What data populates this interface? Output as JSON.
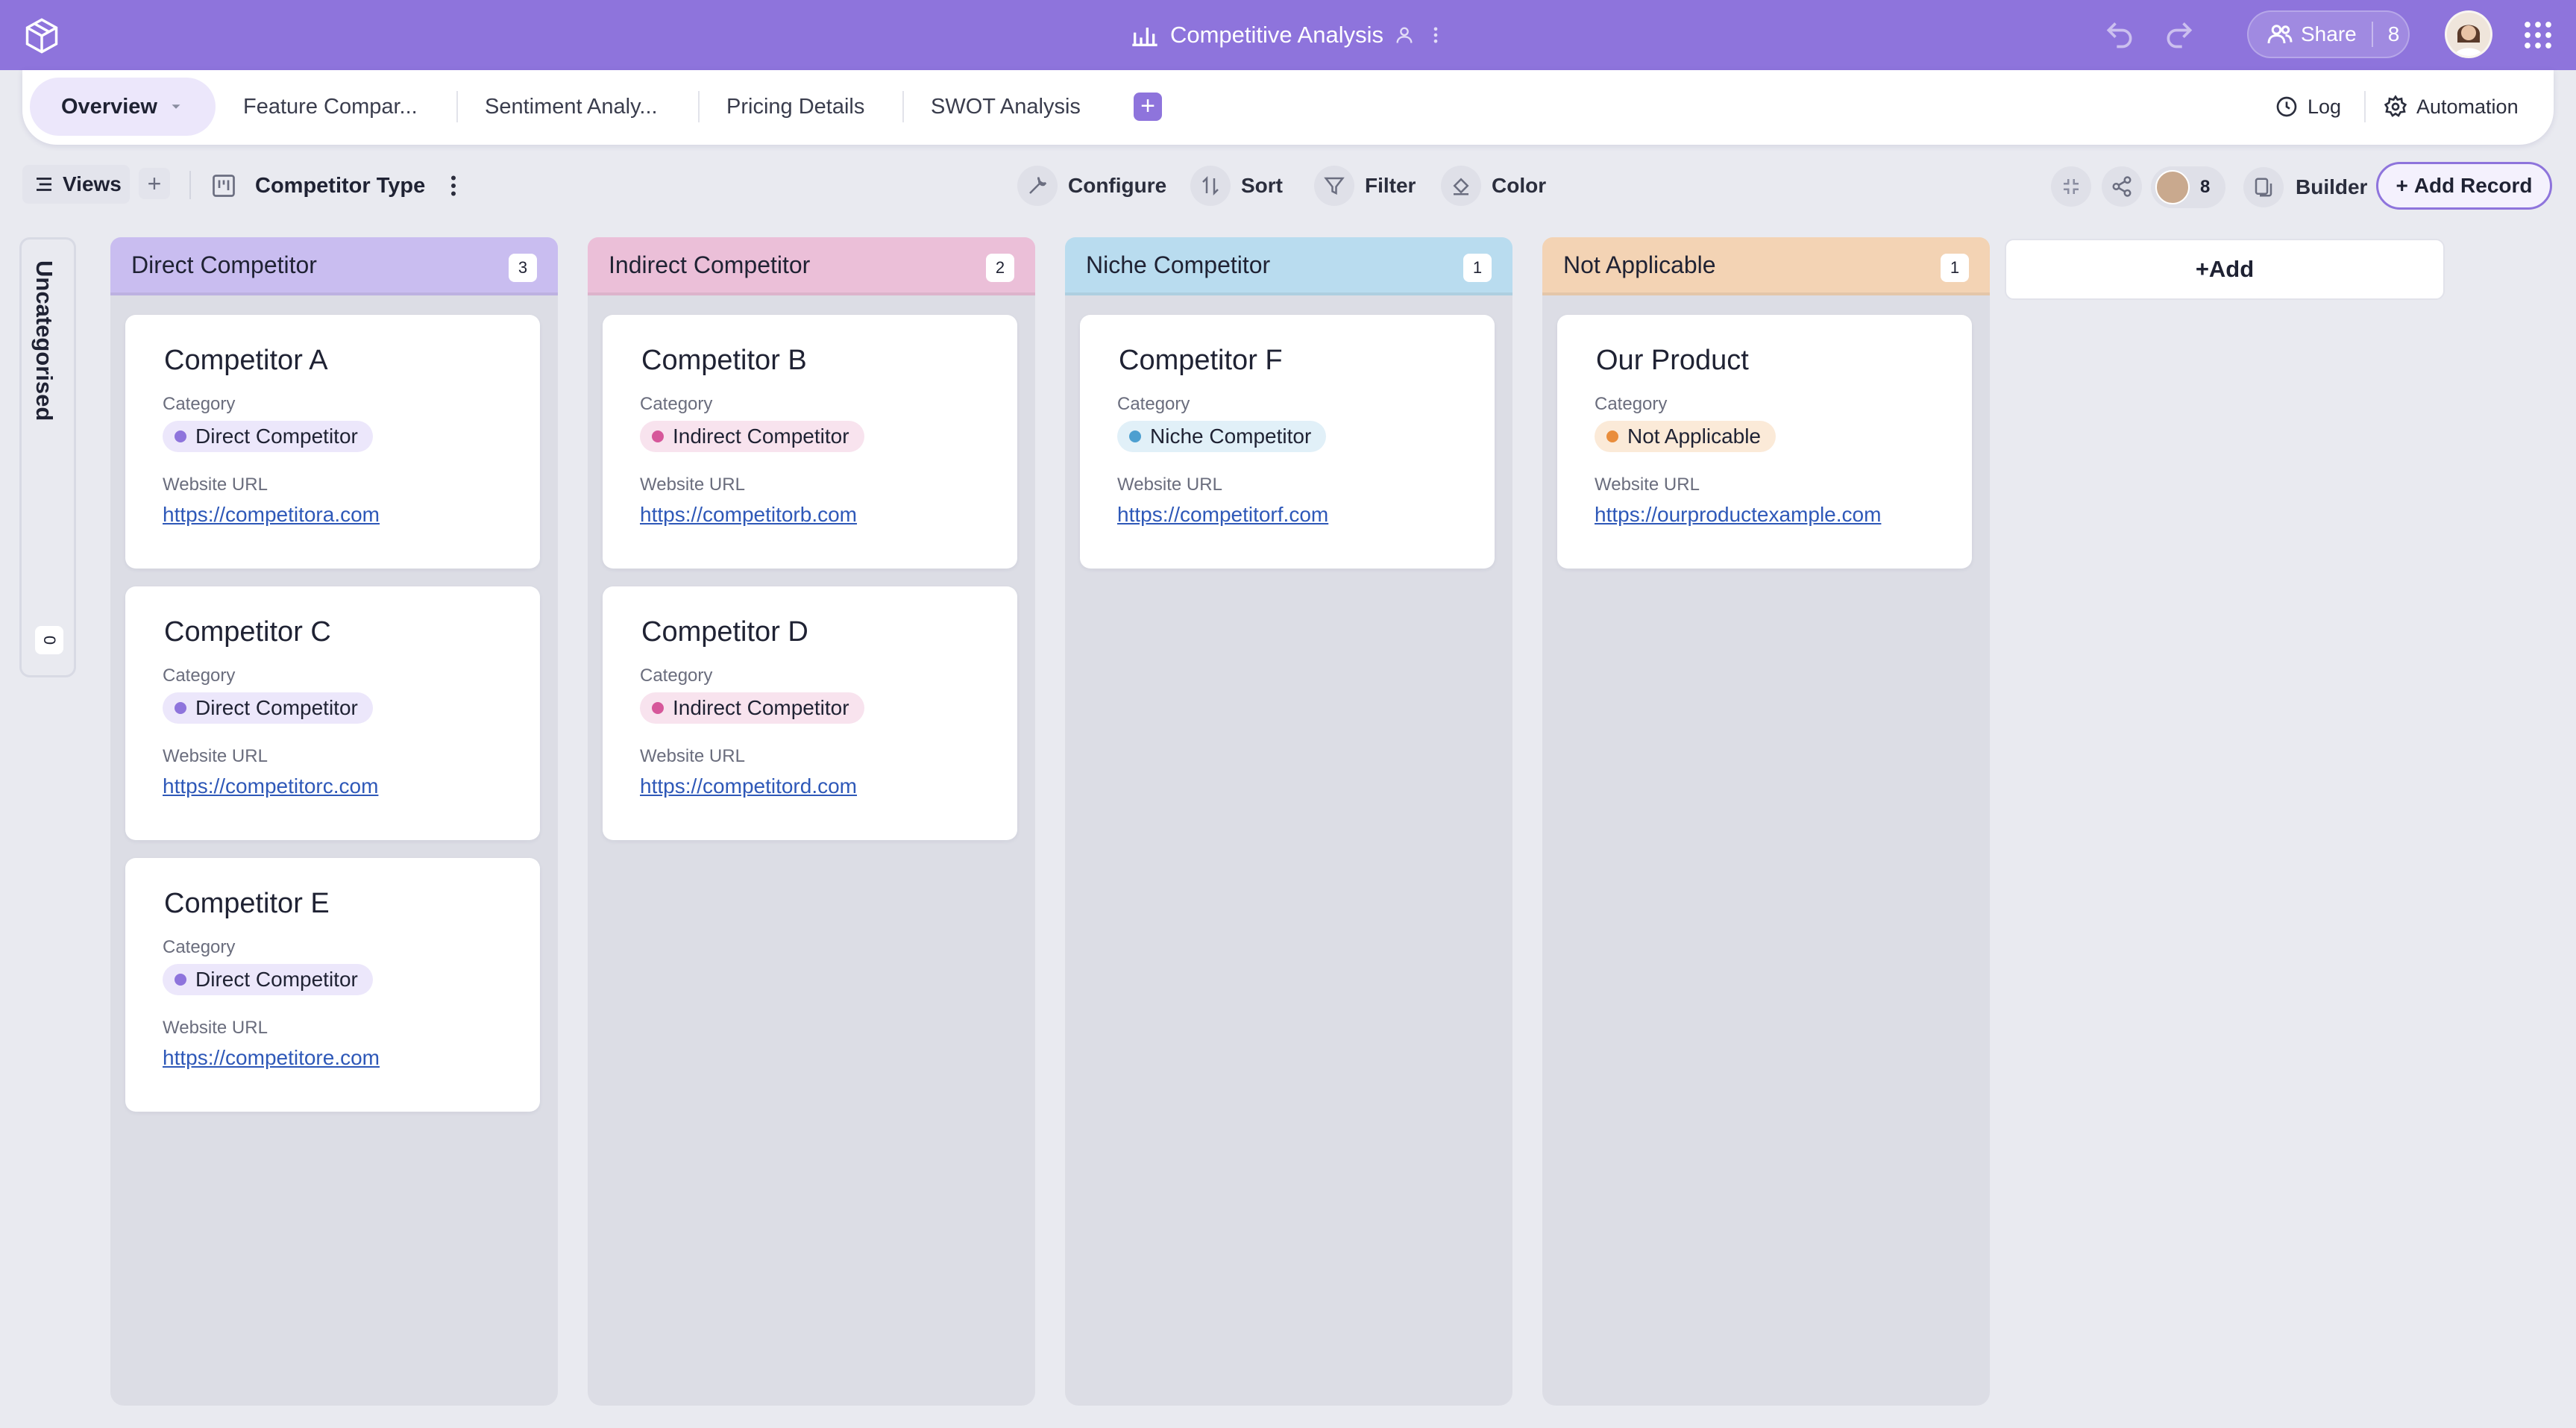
{
  "app": {
    "title": "Competitive Analysis",
    "accent": "#8e74dc"
  },
  "topbar": {
    "share_label": "Share",
    "share_count": "8"
  },
  "tabs": [
    {
      "label": "Overview",
      "active": true
    },
    {
      "label": "Feature Compar..."
    },
    {
      "label": "Sentiment Analy..."
    },
    {
      "label": "Pricing Details"
    },
    {
      "label": "SWOT Analysis"
    }
  ],
  "tab_actions": {
    "log": "Log",
    "automation": "Automation"
  },
  "toolbar": {
    "views": "Views",
    "group_by": "Competitor Type",
    "configure": "Configure",
    "sort": "Sort",
    "filter": "Filter",
    "color": "Color",
    "collaborators": "8",
    "builder": "Builder",
    "add_record": "Add Record"
  },
  "board": {
    "uncategorised": {
      "label": "Uncategorised",
      "count": "0"
    },
    "add_column": "Add",
    "field_labels": {
      "category": "Category",
      "website": "Website URL"
    },
    "columns": [
      {
        "title": "Direct Competitor",
        "count": "3",
        "color": "#c9bdf0",
        "dot": "#8e74dc",
        "pill": "#ece7fb",
        "cards": [
          {
            "name": "Competitor A",
            "category": "Direct Competitor",
            "url": "https://competitora.com"
          },
          {
            "name": "Competitor C",
            "category": "Direct Competitor",
            "url": "https://competitorc.com"
          },
          {
            "name": "Competitor E",
            "category": "Direct Competitor",
            "url": "https://competitore.com"
          }
        ]
      },
      {
        "title": "Indirect Competitor",
        "count": "2",
        "color": "#ebbfd8",
        "dot": "#d6579a",
        "pill": "#f8e3ee",
        "cards": [
          {
            "name": "Competitor B",
            "category": "Indirect Competitor",
            "url": "https://competitorb.com"
          },
          {
            "name": "Competitor D",
            "category": "Indirect Competitor",
            "url": "https://competitord.com"
          }
        ]
      },
      {
        "title": "Niche Competitor",
        "count": "1",
        "color": "#b9dcef",
        "dot": "#4d9fd0",
        "pill": "#e1f0f8",
        "cards": [
          {
            "name": "Competitor F",
            "category": "Niche Competitor",
            "url": "https://competitorf.com"
          }
        ]
      },
      {
        "title": "Not Applicable",
        "count": "1",
        "color": "#f3d3b4",
        "dot": "#e98d3c",
        "pill": "#fbead8",
        "cards": [
          {
            "name": "Our Product",
            "category": "Not Applicable",
            "url": "https://ourproductexample.com"
          }
        ]
      }
    ]
  }
}
